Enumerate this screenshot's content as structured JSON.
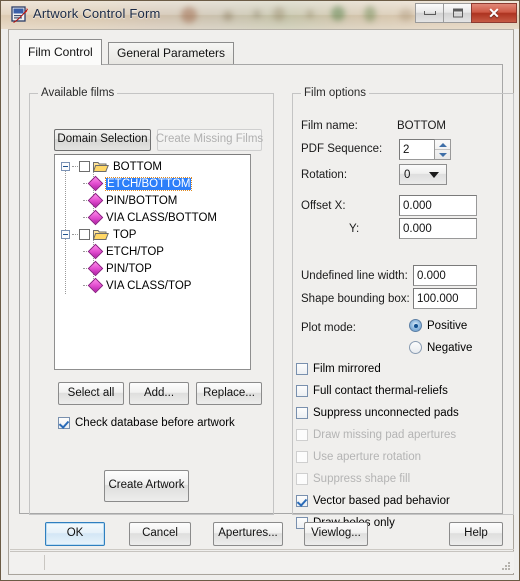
{
  "window": {
    "title": "Artwork Control Form",
    "icon": "artwork-form-icon",
    "minimize_label": "Minimize",
    "maximize_label": "Maximize",
    "close_label": "Close"
  },
  "tabs": [
    {
      "label": "Film Control",
      "active": true
    },
    {
      "label": "General Parameters",
      "active": false
    }
  ],
  "available_films": {
    "group_label": "Available films",
    "domain_selection_label": "Domain Selection",
    "create_missing_films_label": "Create Missing Films",
    "tree": [
      {
        "label": "BOTTOM",
        "level": 0,
        "type": "folder",
        "checked": false,
        "selected": false,
        "expanded": true
      },
      {
        "label": "ETCH/BOTTOM",
        "level": 1,
        "type": "film",
        "checked": false,
        "selected": true
      },
      {
        "label": "PIN/BOTTOM",
        "level": 1,
        "type": "film",
        "checked": false,
        "selected": false
      },
      {
        "label": "VIA CLASS/BOTTOM",
        "level": 1,
        "type": "film",
        "checked": false,
        "selected": false
      },
      {
        "label": "TOP",
        "level": 0,
        "type": "folder",
        "checked": false,
        "selected": false,
        "expanded": true
      },
      {
        "label": "ETCH/TOP",
        "level": 1,
        "type": "film",
        "checked": false,
        "selected": false
      },
      {
        "label": "PIN/TOP",
        "level": 1,
        "type": "film",
        "checked": false,
        "selected": false
      },
      {
        "label": "VIA CLASS/TOP",
        "level": 1,
        "type": "film",
        "checked": false,
        "selected": false
      }
    ],
    "select_all_label": "Select all",
    "add_label": "Add...",
    "replace_label": "Replace...",
    "check_database_label": "Check database before artwork",
    "check_database_checked": true,
    "create_artwork_label": "Create Artwork"
  },
  "film_options": {
    "group_label": "Film options",
    "film_name_label": "Film name:",
    "film_name_value": "BOTTOM",
    "pdf_sequence_label": "PDF Sequence:",
    "pdf_sequence_value": "2",
    "rotation_label": "Rotation:",
    "rotation_value": "0",
    "offset_x_label": "Offset  X:",
    "offset_x_value": "0.000",
    "offset_y_label": "Y:",
    "offset_y_value": "0.000",
    "undefined_line_width_label": "Undefined line width:",
    "undefined_line_width_value": "0.000",
    "shape_bounding_box_label": "Shape bounding box:",
    "shape_bounding_box_value": "100.000",
    "plot_mode_label": "Plot mode:",
    "plot_mode_options": [
      {
        "label": "Positive",
        "selected": true
      },
      {
        "label": "Negative",
        "selected": false
      }
    ],
    "checkboxes": [
      {
        "label": "Film mirrored",
        "checked": false,
        "enabled": true
      },
      {
        "label": "Full contact thermal-reliefs",
        "checked": false,
        "enabled": true
      },
      {
        "label": "Suppress unconnected pads",
        "checked": false,
        "enabled": true
      },
      {
        "label": "Draw missing pad apertures",
        "checked": false,
        "enabled": false
      },
      {
        "label": "Use aperture rotation",
        "checked": false,
        "enabled": false
      },
      {
        "label": "Suppress shape fill",
        "checked": false,
        "enabled": false
      },
      {
        "label": "Vector based pad behavior",
        "checked": true,
        "enabled": true
      },
      {
        "label": "Draw holes only",
        "checked": false,
        "enabled": true
      }
    ]
  },
  "footer": {
    "ok_label": "OK",
    "cancel_label": "Cancel",
    "apertures_label": "Apertures...",
    "viewlog_label": "Viewlog...",
    "help_label": "Help"
  },
  "colors": {
    "selection_blue": "#2d7ff9",
    "focus_orange": "#e08a21",
    "film_icon_magenta": "#e34fd0",
    "default_button_blue": "#2f7fbf",
    "close_button_red": "#ad3320"
  }
}
